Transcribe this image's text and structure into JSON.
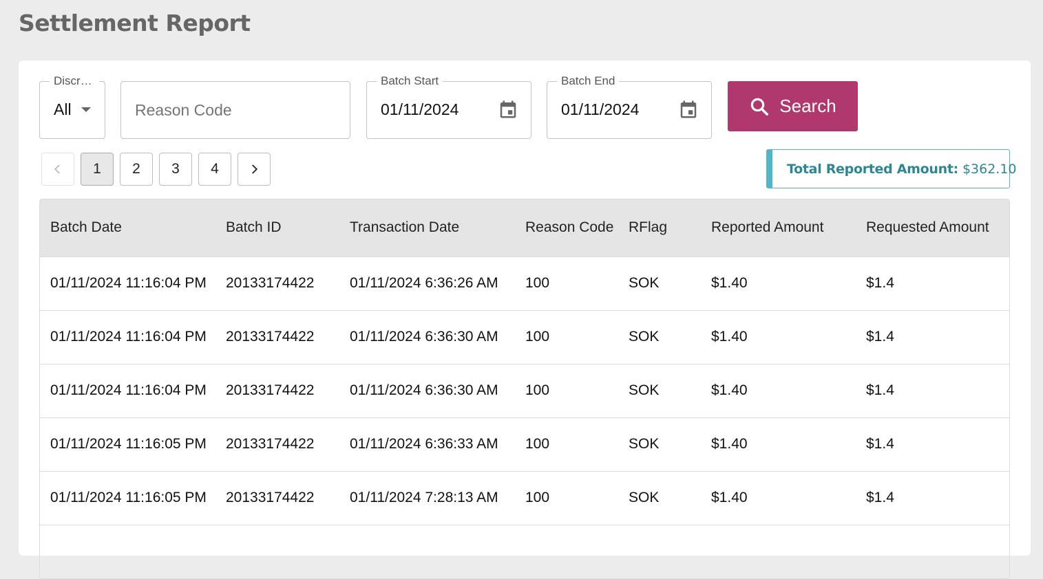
{
  "page": {
    "title": "Settlement Report"
  },
  "filters": {
    "discrepancy": {
      "label": "Discrepancy",
      "value": "All"
    },
    "reason_code": {
      "placeholder": "Reason Code",
      "value": ""
    },
    "batch_start": {
      "label": "Batch Start",
      "value": "01/11/2024"
    },
    "batch_end": {
      "label": "Batch End",
      "value": "01/11/2024"
    },
    "search_label": "Search"
  },
  "pagination": {
    "pages": [
      "1",
      "2",
      "3",
      "4"
    ],
    "current": "1"
  },
  "total": {
    "label": "Total Reported Amount:",
    "value": "$362.10"
  },
  "colors": {
    "accent": "#b0386d",
    "info": "#52b6c6",
    "info_text": "#2c8795"
  },
  "table": {
    "headers": [
      "Batch Date",
      "Batch ID",
      "Transaction Date",
      "Reason Code",
      "RFlag",
      "Reported Amount",
      "Requested Amount"
    ],
    "rows": [
      [
        "01/11/2024 11:16:04 PM",
        "20133174422",
        "01/11/2024 6:36:26 AM",
        "100",
        "SOK",
        "$1.40",
        "$1.4"
      ],
      [
        "01/11/2024 11:16:04 PM",
        "20133174422",
        "01/11/2024 6:36:30 AM",
        "100",
        "SOK",
        "$1.40",
        "$1.4"
      ],
      [
        "01/11/2024 11:16:04 PM",
        "20133174422",
        "01/11/2024 6:36:30 AM",
        "100",
        "SOK",
        "$1.40",
        "$1.4"
      ],
      [
        "01/11/2024 11:16:05 PM",
        "20133174422",
        "01/11/2024 6:36:33 AM",
        "100",
        "SOK",
        "$1.40",
        "$1.4"
      ],
      [
        "01/11/2024 11:16:05 PM",
        "20133174422",
        "01/11/2024 7:28:13 AM",
        "100",
        "SOK",
        "$1.40",
        "$1.4"
      ],
      [
        "",
        "",
        "",
        "",
        "",
        "",
        ""
      ]
    ]
  }
}
